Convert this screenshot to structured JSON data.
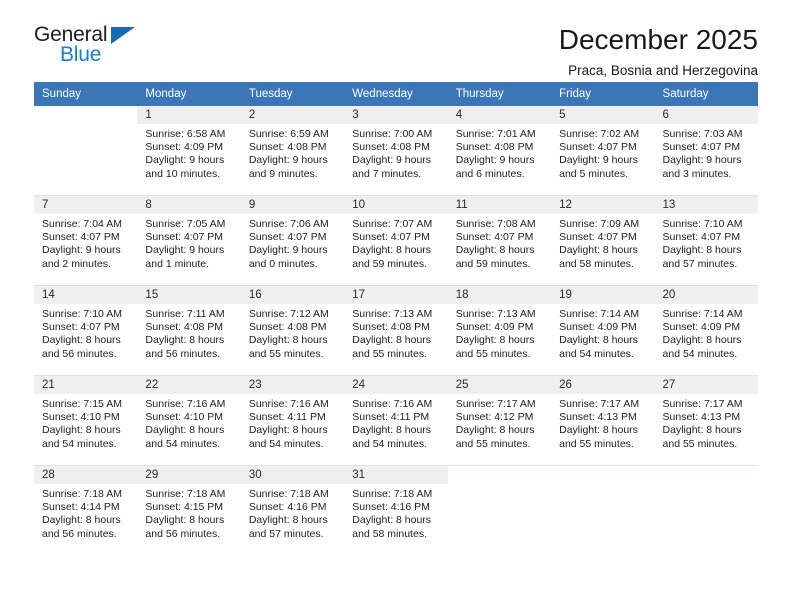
{
  "brand": {
    "word_general": "General",
    "word_blue": "Blue",
    "triangle_color": "#1a6bb5",
    "blue_color": "#1a7fd4"
  },
  "header": {
    "month_title": "December 2025",
    "location": "Praca, Bosnia and Herzegovina",
    "header_bg": "#3b76b8",
    "daynum_bg": "#efefef"
  },
  "weekday_headers": [
    "Sunday",
    "Monday",
    "Tuesday",
    "Wednesday",
    "Thursday",
    "Friday",
    "Saturday"
  ],
  "weeks": [
    [
      {
        "day": "",
        "lines": []
      },
      {
        "day": "1",
        "lines": [
          "Sunrise: 6:58 AM",
          "Sunset: 4:09 PM",
          "Daylight: 9 hours",
          "and 10 minutes."
        ]
      },
      {
        "day": "2",
        "lines": [
          "Sunrise: 6:59 AM",
          "Sunset: 4:08 PM",
          "Daylight: 9 hours",
          "and 9 minutes."
        ]
      },
      {
        "day": "3",
        "lines": [
          "Sunrise: 7:00 AM",
          "Sunset: 4:08 PM",
          "Daylight: 9 hours",
          "and 7 minutes."
        ]
      },
      {
        "day": "4",
        "lines": [
          "Sunrise: 7:01 AM",
          "Sunset: 4:08 PM",
          "Daylight: 9 hours",
          "and 6 minutes."
        ]
      },
      {
        "day": "5",
        "lines": [
          "Sunrise: 7:02 AM",
          "Sunset: 4:07 PM",
          "Daylight: 9 hours",
          "and 5 minutes."
        ]
      },
      {
        "day": "6",
        "lines": [
          "Sunrise: 7:03 AM",
          "Sunset: 4:07 PM",
          "Daylight: 9 hours",
          "and 3 minutes."
        ]
      }
    ],
    [
      {
        "day": "7",
        "lines": [
          "Sunrise: 7:04 AM",
          "Sunset: 4:07 PM",
          "Daylight: 9 hours",
          "and 2 minutes."
        ]
      },
      {
        "day": "8",
        "lines": [
          "Sunrise: 7:05 AM",
          "Sunset: 4:07 PM",
          "Daylight: 9 hours",
          "and 1 minute."
        ]
      },
      {
        "day": "9",
        "lines": [
          "Sunrise: 7:06 AM",
          "Sunset: 4:07 PM",
          "Daylight: 9 hours",
          "and 0 minutes."
        ]
      },
      {
        "day": "10",
        "lines": [
          "Sunrise: 7:07 AM",
          "Sunset: 4:07 PM",
          "Daylight: 8 hours",
          "and 59 minutes."
        ]
      },
      {
        "day": "11",
        "lines": [
          "Sunrise: 7:08 AM",
          "Sunset: 4:07 PM",
          "Daylight: 8 hours",
          "and 59 minutes."
        ]
      },
      {
        "day": "12",
        "lines": [
          "Sunrise: 7:09 AM",
          "Sunset: 4:07 PM",
          "Daylight: 8 hours",
          "and 58 minutes."
        ]
      },
      {
        "day": "13",
        "lines": [
          "Sunrise: 7:10 AM",
          "Sunset: 4:07 PM",
          "Daylight: 8 hours",
          "and 57 minutes."
        ]
      }
    ],
    [
      {
        "day": "14",
        "lines": [
          "Sunrise: 7:10 AM",
          "Sunset: 4:07 PM",
          "Daylight: 8 hours",
          "and 56 minutes."
        ]
      },
      {
        "day": "15",
        "lines": [
          "Sunrise: 7:11 AM",
          "Sunset: 4:08 PM",
          "Daylight: 8 hours",
          "and 56 minutes."
        ]
      },
      {
        "day": "16",
        "lines": [
          "Sunrise: 7:12 AM",
          "Sunset: 4:08 PM",
          "Daylight: 8 hours",
          "and 55 minutes."
        ]
      },
      {
        "day": "17",
        "lines": [
          "Sunrise: 7:13 AM",
          "Sunset: 4:08 PM",
          "Daylight: 8 hours",
          "and 55 minutes."
        ]
      },
      {
        "day": "18",
        "lines": [
          "Sunrise: 7:13 AM",
          "Sunset: 4:09 PM",
          "Daylight: 8 hours",
          "and 55 minutes."
        ]
      },
      {
        "day": "19",
        "lines": [
          "Sunrise: 7:14 AM",
          "Sunset: 4:09 PM",
          "Daylight: 8 hours",
          "and 54 minutes."
        ]
      },
      {
        "day": "20",
        "lines": [
          "Sunrise: 7:14 AM",
          "Sunset: 4:09 PM",
          "Daylight: 8 hours",
          "and 54 minutes."
        ]
      }
    ],
    [
      {
        "day": "21",
        "lines": [
          "Sunrise: 7:15 AM",
          "Sunset: 4:10 PM",
          "Daylight: 8 hours",
          "and 54 minutes."
        ]
      },
      {
        "day": "22",
        "lines": [
          "Sunrise: 7:16 AM",
          "Sunset: 4:10 PM",
          "Daylight: 8 hours",
          "and 54 minutes."
        ]
      },
      {
        "day": "23",
        "lines": [
          "Sunrise: 7:16 AM",
          "Sunset: 4:11 PM",
          "Daylight: 8 hours",
          "and 54 minutes."
        ]
      },
      {
        "day": "24",
        "lines": [
          "Sunrise: 7:16 AM",
          "Sunset: 4:11 PM",
          "Daylight: 8 hours",
          "and 54 minutes."
        ]
      },
      {
        "day": "25",
        "lines": [
          "Sunrise: 7:17 AM",
          "Sunset: 4:12 PM",
          "Daylight: 8 hours",
          "and 55 minutes."
        ]
      },
      {
        "day": "26",
        "lines": [
          "Sunrise: 7:17 AM",
          "Sunset: 4:13 PM",
          "Daylight: 8 hours",
          "and 55 minutes."
        ]
      },
      {
        "day": "27",
        "lines": [
          "Sunrise: 7:17 AM",
          "Sunset: 4:13 PM",
          "Daylight: 8 hours",
          "and 55 minutes."
        ]
      }
    ],
    [
      {
        "day": "28",
        "lines": [
          "Sunrise: 7:18 AM",
          "Sunset: 4:14 PM",
          "Daylight: 8 hours",
          "and 56 minutes."
        ]
      },
      {
        "day": "29",
        "lines": [
          "Sunrise: 7:18 AM",
          "Sunset: 4:15 PM",
          "Daylight: 8 hours",
          "and 56 minutes."
        ]
      },
      {
        "day": "30",
        "lines": [
          "Sunrise: 7:18 AM",
          "Sunset: 4:16 PM",
          "Daylight: 8 hours",
          "and 57 minutes."
        ]
      },
      {
        "day": "31",
        "lines": [
          "Sunrise: 7:18 AM",
          "Sunset: 4:16 PM",
          "Daylight: 8 hours",
          "and 58 minutes."
        ]
      },
      {
        "day": "",
        "lines": []
      },
      {
        "day": "",
        "lines": []
      },
      {
        "day": "",
        "lines": []
      }
    ]
  ]
}
